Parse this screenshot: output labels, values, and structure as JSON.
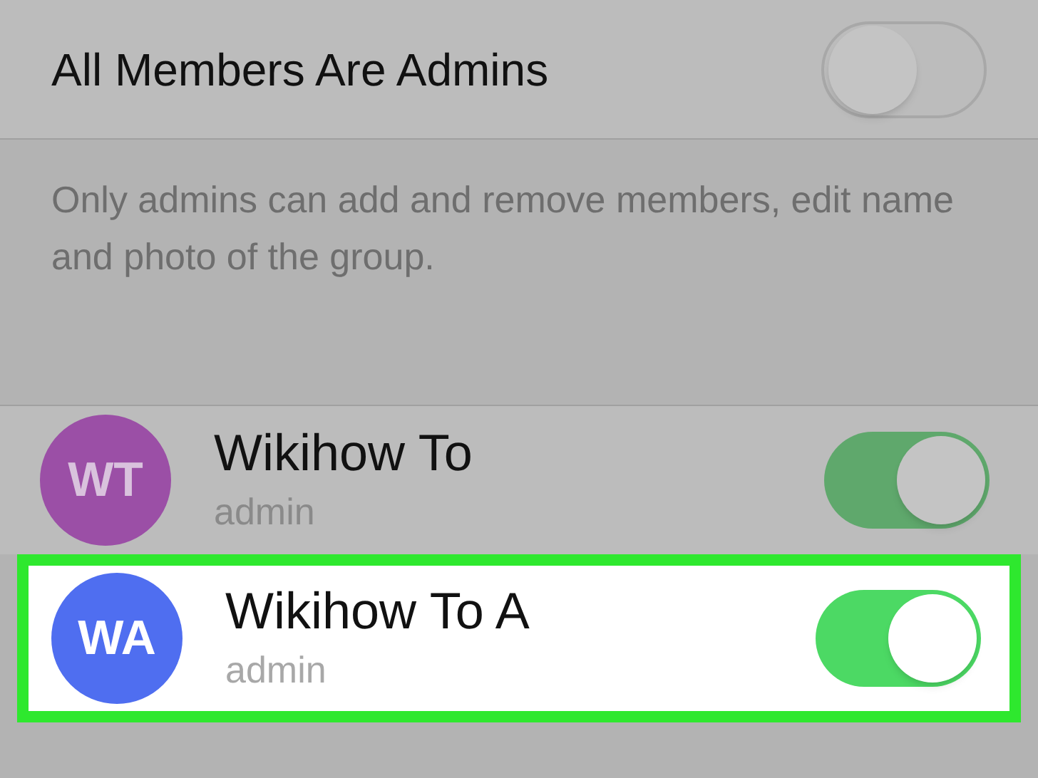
{
  "setting": {
    "label": "All Members Are Admins",
    "on": false
  },
  "note": "Only admins can add and remove members, edit name and photo of the group.",
  "members": [
    {
      "initials": "WT",
      "name": "Wikihow To",
      "role": "admin",
      "color": "#9b4fa6",
      "on": true,
      "highlighted": false
    },
    {
      "initials": "WA",
      "name": "Wikihow To A",
      "role": "admin",
      "color": "#4f6ef0",
      "on": true,
      "highlighted": true
    }
  ]
}
